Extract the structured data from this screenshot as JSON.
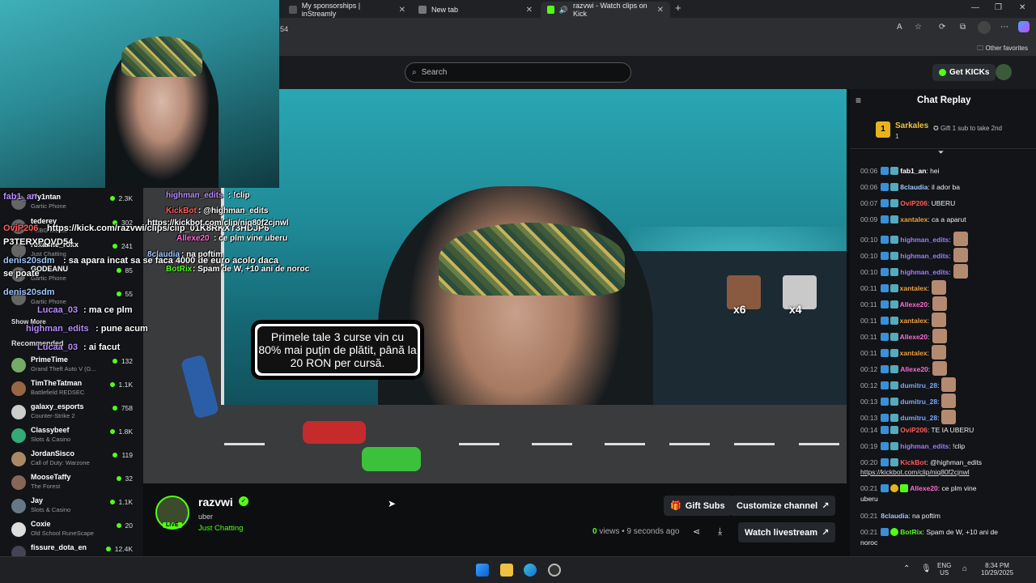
{
  "browser": {
    "tabs": [
      {
        "title": "My sponsorships | inStreamly"
      },
      {
        "title": "New tab"
      },
      {
        "title": "razvwi - Watch clips on Kick"
      }
    ],
    "address_fragment": "54",
    "other_favorites": "Other favorites"
  },
  "header": {
    "search_placeholder": "Search",
    "get_kicks": "Get KICKs"
  },
  "video": {
    "promo_text": "Primele tale 3 curse vin cu 80% mai puțin de plătit, până la 20 RON per cursă.",
    "emote_counts": [
      "x6",
      "x4"
    ]
  },
  "overlay_chat_left": [
    {
      "user": "fab1_an",
      "text": ""
    },
    {
      "user": "OviP206",
      "text": "https://kick.com/razvwi/clips/clip_01K8RKXT3HDJP6"
    },
    {
      "user": "",
      "text": "P3TERXPQVD54"
    },
    {
      "user": "denis20sdm",
      "text": ": sa apara incat sa se faca 4000 de euro acolo daca"
    },
    {
      "user": "",
      "text": "se poate"
    },
    {
      "user": "denis20sdm",
      "text": ""
    },
    {
      "user": "Lucaa_03",
      "text": ": ma ce plm"
    },
    {
      "user": "highman_edits",
      "text": ": pune acum"
    },
    {
      "user": "Lucaa_03",
      "text": ": ai facut"
    }
  ],
  "overlay_chat_stream": [
    {
      "user": "highman_edits",
      "text": ": !clip"
    },
    {
      "user": "KickBot",
      "text": ": @highman_edits"
    },
    {
      "user": "",
      "text": "https://kickbot.com/clip/niq80f2cjnwl"
    },
    {
      "user": "Allexe20",
      "text": ": ce plm vine uberu"
    },
    {
      "user": "8claudia",
      "text": ": na poftim"
    },
    {
      "user": "BotRix",
      "text": ": Spam de W, +10 ani de noroc"
    }
  ],
  "sidebar": {
    "show_more": "Show More",
    "recommended": "Recommended",
    "top_items": [
      {
        "name": "Fly1ntan",
        "game": "Gartic Phone",
        "count": "2.3K"
      },
      {
        "name": "tederey",
        "game": "PUBG Mobile",
        "count": "302"
      },
      {
        "name": "roxanne_roxx",
        "game": "Just Chatting",
        "count": "241"
      },
      {
        "name": "GODEANU",
        "game": "Gartic Phone",
        "count": "85"
      },
      {
        "name": "",
        "game": "Gartic Phone",
        "count": "55"
      }
    ],
    "items": [
      {
        "name": "PrimeTime",
        "game": "Grand Theft Auto V (G...",
        "count": "132"
      },
      {
        "name": "TimTheTatman",
        "game": "Battlefield REDSEC",
        "count": "1.1K"
      },
      {
        "name": "galaxy_esports",
        "game": "Counter-Strike 2",
        "count": "758"
      },
      {
        "name": "Classybeef",
        "game": "Slots & Casino",
        "count": "1.8K"
      },
      {
        "name": "JordanSisco",
        "game": "Call of Duty: Warzone",
        "count": "119"
      },
      {
        "name": "MooseTaffy",
        "game": "The Forest",
        "count": "32"
      },
      {
        "name": "Jay",
        "game": "Slots & Casino",
        "count": "1.1K"
      },
      {
        "name": "Coxie",
        "game": "Old School RuneScape",
        "count": "20"
      },
      {
        "name": "fissure_dota_en",
        "game": "",
        "count": "12.4K"
      }
    ]
  },
  "channel": {
    "name": "razvwi",
    "subtitle": "uber",
    "category": "Just Chatting",
    "live": "LIVE",
    "views_count": "0",
    "views_label": "views",
    "time_ago": "• 9 seconds ago",
    "gift_subs": "Gift Subs",
    "customize": "Customize channel",
    "watch_livestream": "Watch livestream"
  },
  "chat": {
    "title": "Chat Replay",
    "top_gifter": {
      "rank": "1",
      "name": "Sarkales",
      "count": "1",
      "hint": "Gift 1 sub to take 2nd"
    },
    "messages": [
      {
        "time": "00:06",
        "user": "fab1_an",
        "color": "#ffffff",
        "text": ": hei",
        "emotes": 0
      },
      {
        "time": "00:06",
        "user": "8claudia",
        "color": "#9fc6ff",
        "text": ": il ador ba",
        "emotes": 0
      },
      {
        "time": "00:07",
        "user": "OviP206",
        "color": "#ff5b5b",
        "text": ": UBERU",
        "emotes": 0
      },
      {
        "time": "00:09",
        "user": "xantalex",
        "color": "#f0a040",
        "text": ": ca a aparut",
        "emotes": 0
      },
      {
        "time": "00:10",
        "user": "highman_edits",
        "color": "#9f7dff",
        "text": ":",
        "emotes": 1
      },
      {
        "time": "00:10",
        "user": "highman_edits",
        "color": "#9f7dff",
        "text": ":",
        "emotes": 1
      },
      {
        "time": "00:10",
        "user": "highman_edits",
        "color": "#9f7dff",
        "text": ":",
        "emotes": 1
      },
      {
        "time": "00:11",
        "user": "xantalex",
        "color": "#f0a040",
        "text": ":",
        "emotes": 1
      },
      {
        "time": "00:11",
        "user": "Allexe20",
        "color": "#ff6ad5",
        "text": ":",
        "emotes": 1
      },
      {
        "time": "00:11",
        "user": "xantalex",
        "color": "#f0a040",
        "text": ":",
        "emotes": 1
      },
      {
        "time": "00:11",
        "user": "Allexe20",
        "color": "#ff6ad5",
        "text": ":",
        "emotes": 1
      },
      {
        "time": "00:11",
        "user": "xantalex",
        "color": "#f0a040",
        "text": ":",
        "emotes": 1
      },
      {
        "time": "00:12",
        "user": "Allexe20",
        "color": "#ff6ad5",
        "text": ":",
        "emotes": 1
      },
      {
        "time": "00:12",
        "user": "dumitru_28",
        "color": "#7aa8ff",
        "text": ":",
        "emotes": 1
      },
      {
        "time": "00:13",
        "user": "dumitru_28",
        "color": "#7aa8ff",
        "text": ":",
        "emotes": 1
      },
      {
        "time": "00:13",
        "user": "dumitru_28",
        "color": "#7aa8ff",
        "text": ":",
        "emotes": 1
      },
      {
        "time": "00:14",
        "user": "OviP206",
        "color": "#ff5b5b",
        "text": ": TE IA UBERU",
        "emotes": 0
      },
      {
        "time": "00:19",
        "user": "highman_edits",
        "color": "#9f7dff",
        "text": ": !clip",
        "emotes": 0
      },
      {
        "time": "00:20",
        "user": "KickBot",
        "color": "#ff5b5b",
        "text": ": @highman_edits",
        "emotes": 0
      }
    ],
    "kickbot_link": "https://kickbot.com/clip/niq80f2cjnwl",
    "late_messages": [
      {
        "time": "00:21",
        "user": "Allexe20",
        "color": "#ff6ad5",
        "text": ": ce plm vine"
      },
      {
        "time": "",
        "user": "",
        "color": "#ffffff",
        "text": "uberu"
      },
      {
        "time": "00:21",
        "user": "8claudia",
        "color": "#9fc6ff",
        "text": ": na poftim"
      },
      {
        "time": "00:21",
        "user": "BotRix",
        "color": "#53fc18",
        "text": ": Spam de W, +10 ani de"
      },
      {
        "time": "",
        "user": "",
        "color": "#ffffff",
        "text": "noroc"
      }
    ]
  },
  "taskbar": {
    "lang": "ENG",
    "region": "US",
    "time": "8:34 PM",
    "date": "10/29/2025"
  }
}
